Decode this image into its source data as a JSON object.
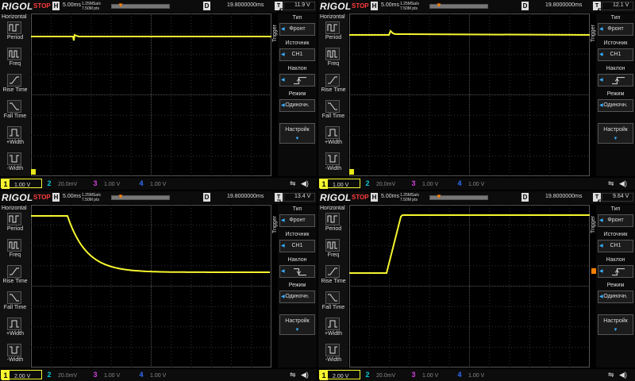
{
  "brand": "RIGOL",
  "status": "STOP",
  "horizontal_label": "H",
  "delay_label": "D",
  "trigger_type_label": "T",
  "left_menu": {
    "title": "Horizontal",
    "items": [
      "Period",
      "Freq",
      "Rise Time",
      "Fall Time",
      "+Width",
      "-Width"
    ]
  },
  "right_menu": {
    "side_label": "Trigger",
    "type_title": "Тип",
    "type_value": "Фронт",
    "source_title": "Источник",
    "source_value": "CH1",
    "slope_title": "Наклон",
    "mode_title": "Режим",
    "mode_value": "Одиночн.",
    "settings_label": "Настройк"
  },
  "colors": {
    "ch1": "#f5f530",
    "ch2": "#00c8d8",
    "ch3": "#d040d8",
    "ch4": "#3070ff",
    "accent": "#38b0ff",
    "stop": "#ff3b3b",
    "trigger": "#ff8000"
  },
  "panels": [
    {
      "timebase": "5.00ms",
      "sample_rate": "1.25MSa/s",
      "memory_depth": "7.50M pts",
      "delay": "19.8000000ms",
      "trigger_level": "11.9 V",
      "slope_icon": "rising-edge-icon",
      "channels": [
        {
          "num": "1",
          "value": "1.00 V"
        },
        {
          "num": "2",
          "value": "20.0mV"
        },
        {
          "num": "3",
          "value": "1.00 V"
        },
        {
          "num": "4",
          "value": "1.00 V"
        }
      ]
    },
    {
      "timebase": "5.00ms",
      "sample_rate": "1.25MSa/s",
      "memory_depth": "7.50M pts",
      "delay": "19.8000000ms",
      "trigger_level": "12.1 V",
      "slope_icon": "rising-edge-icon",
      "channels": [
        {
          "num": "1",
          "value": "1.00 V"
        },
        {
          "num": "2",
          "value": "20.0mV"
        },
        {
          "num": "3",
          "value": "1.00 V"
        },
        {
          "num": "4",
          "value": "1.00 V"
        }
      ]
    },
    {
      "timebase": "5.00ms",
      "sample_rate": "1.25MSa/s",
      "memory_depth": "7.50M pts",
      "delay": "19.8000000ms",
      "trigger_level": "13.4 V",
      "slope_icon": "falling-edge-icon",
      "channels": [
        {
          "num": "1",
          "value": "2.00 V"
        },
        {
          "num": "2",
          "value": "20.0mV"
        },
        {
          "num": "3",
          "value": "1.00 V"
        },
        {
          "num": "4",
          "value": "1.00 V"
        }
      ]
    },
    {
      "timebase": "5.00ms",
      "sample_rate": "1.25MSa/s",
      "memory_depth": "7.50M pts",
      "delay": "19.8000000ms",
      "trigger_level": "9.64 V",
      "slope_icon": "rising-edge-icon",
      "channels": [
        {
          "num": "1",
          "value": "2.00 V"
        },
        {
          "num": "2",
          "value": "20.0mV"
        },
        {
          "num": "3",
          "value": "1.00 V"
        },
        {
          "num": "4",
          "value": "1.00 V"
        }
      ]
    }
  ]
}
